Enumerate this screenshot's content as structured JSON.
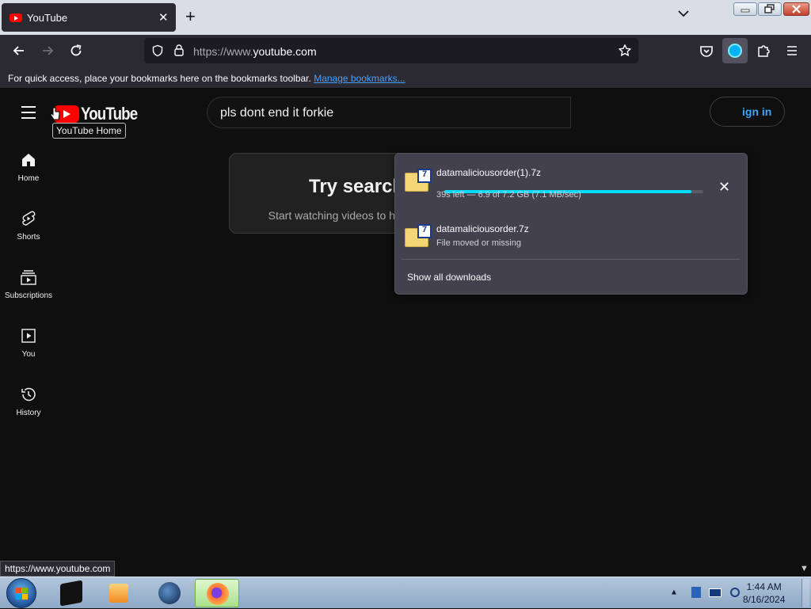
{
  "browser": {
    "tab_title": "YouTube",
    "tab_close": "✕",
    "new_tab": "+",
    "url_prefix": "https://www.",
    "url_domain": "youtube.com",
    "bookmarks_hint": "For quick access, place your bookmarks here on the bookmarks toolbar.",
    "manage_bookmarks": "Manage bookmarks..."
  },
  "youtube": {
    "logo_text": "YouTube",
    "tooltip": "YouTube Home",
    "search_query": "pls dont end it forkie",
    "signin_label": "Sign in",
    "signin_visible": "ign in",
    "sidebar": [
      {
        "label": "Home",
        "icon": "home-icon"
      },
      {
        "label": "Shorts",
        "icon": "shorts-icon"
      },
      {
        "label": "Subscriptions",
        "icon": "subscriptions-icon"
      },
      {
        "label": "You",
        "icon": "you-icon"
      },
      {
        "label": "History",
        "icon": "history-icon"
      }
    ],
    "card_heading": "Try search",
    "card_text": "Start watching videos to help us build a feed of videos you'll love."
  },
  "downloads": {
    "items": [
      {
        "name": "datamaliciousorder(1).7z",
        "status": "39s left — 6.9 of 7.2 GB (7.1 MB/sec)",
        "progress": 0.955
      },
      {
        "name": "datamaliciousorder.7z",
        "status": "File moved or missing"
      }
    ],
    "show_all": "Show all downloads"
  },
  "status_url": "https://www.youtube.com",
  "taskbar": {
    "time": "1:44 AM",
    "date": "8/16/2024"
  },
  "colors": {
    "accent": "#00ddff",
    "youtube_red": "#ff0000",
    "link": "#45a1ff"
  }
}
